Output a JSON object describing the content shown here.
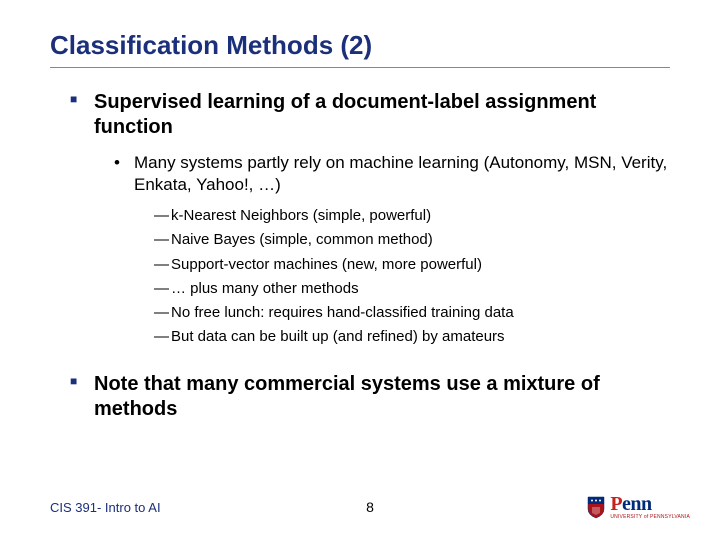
{
  "title": "Classification Methods (2)",
  "bullets": {
    "main1": "Supervised learning of a document-label assignment function",
    "sub1": "Many systems partly rely on machine learning (Autonomy, MSN, Verity, Enkata, Yahoo!, …)",
    "dashes": [
      "k-Nearest Neighbors (simple, powerful)",
      "Naive Bayes (simple, common method)",
      "Support-vector machines (new, more powerful)",
      "… plus many other methods",
      "No free lunch: requires hand-classified training data",
      "But data can be built up (and refined) by amateurs"
    ],
    "main2": "Note that many commercial systems use a mixture of methods"
  },
  "footer": {
    "course": "CIS 391- Intro to AI",
    "page": "8",
    "logo_text": "Penn",
    "logo_sub": "UNIVERSITY of PENNSYLVANIA"
  }
}
